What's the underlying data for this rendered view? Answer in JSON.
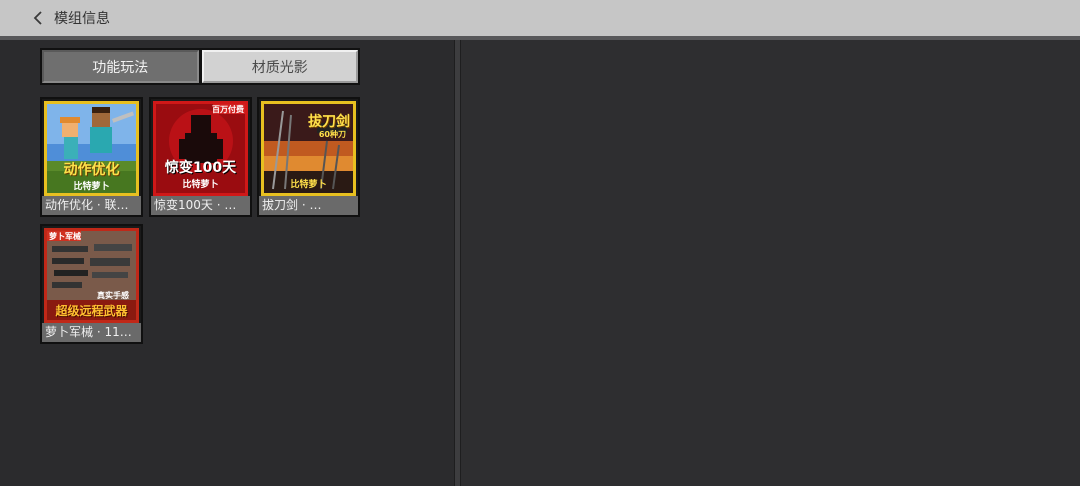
{
  "header": {
    "title": "模组信息",
    "back_icon": "chevron-left-icon"
  },
  "tabs": [
    {
      "label": "功能玩法",
      "active": true
    },
    {
      "label": "材质光影",
      "active": false
    }
  ],
  "mods": [
    {
      "label": "动作优化 · 联…",
      "thumb_title": "动作优化",
      "thumb_sub": "比特萝卜"
    },
    {
      "label": "惊变100天 · …",
      "thumb_title": "惊变100天",
      "thumb_sub": "比特萝卜",
      "thumb_badge": "百万付费"
    },
    {
      "label": "拔刀剑 · …",
      "thumb_title": "拔刀剑",
      "thumb_sub": "比特萝卜",
      "thumb_badge": "60种刀"
    },
    {
      "label": "萝卜军械 · 11…",
      "thumb_title": "超级远程武器",
      "thumb_sub": "真实手感",
      "thumb_badge": "萝卜军械"
    }
  ],
  "colors": {
    "topbar": "#c6c6c6",
    "background": "#2b2b2d",
    "tab_active": "#6f6f6f",
    "tab_inactive": "#d2d2d2"
  }
}
